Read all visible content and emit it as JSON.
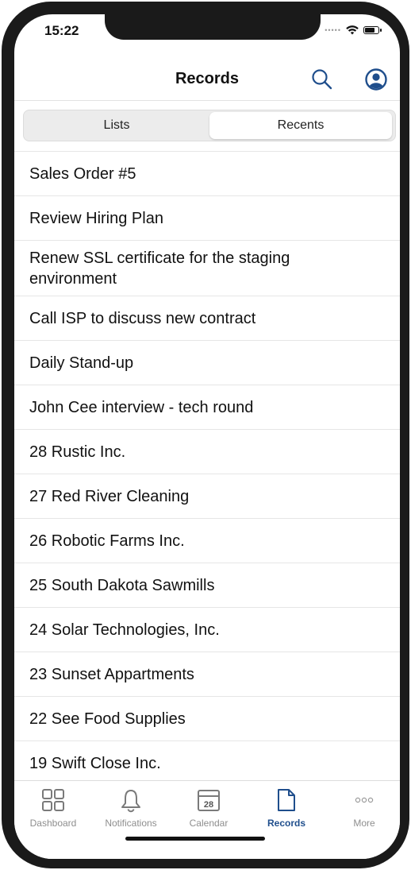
{
  "status_bar": {
    "time": "15:22"
  },
  "nav": {
    "title": "Records"
  },
  "segments": [
    {
      "label": "Lists",
      "active": false
    },
    {
      "label": "Recents",
      "active": true
    }
  ],
  "records": [
    "Sales Order #5",
    "Review Hiring Plan",
    "Renew SSL certificate for the staging environment",
    "Call ISP to discuss new contract",
    "Daily Stand-up",
    "John Cee interview - tech round",
    "28 Rustic Inc.",
    "27 Red River Cleaning",
    "26 Robotic Farms Inc.",
    "25 South Dakota Sawmills",
    "24 Solar Technologies, Inc.",
    "23 Sunset Appartments",
    "22 See Food Supplies",
    "19 Swift Close Inc."
  ],
  "tabbar": {
    "items": [
      {
        "label": "Dashboard",
        "icon": "dashboard-icon",
        "active": false
      },
      {
        "label": "Notifications",
        "icon": "bell-icon",
        "active": false
      },
      {
        "label": "Calendar",
        "icon": "calendar-icon",
        "active": false,
        "day": "28"
      },
      {
        "label": "Records",
        "icon": "document-icon",
        "active": true
      },
      {
        "label": "More",
        "icon": "more-icon",
        "active": false
      }
    ]
  },
  "colors": {
    "accent": "#1f4e8c",
    "text": "#111111",
    "inactive": "#8e8e8e"
  }
}
